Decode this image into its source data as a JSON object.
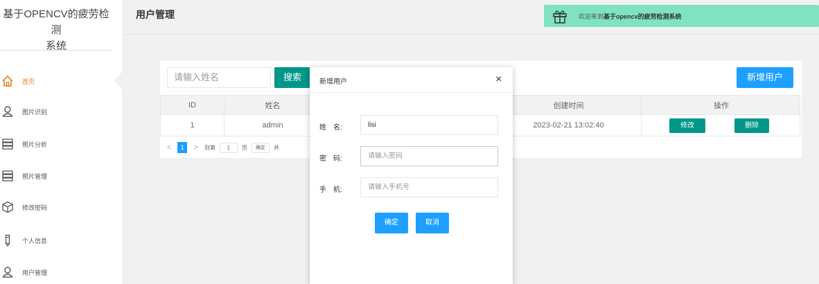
{
  "app": {
    "title_line1": "基于OPENCV的疲劳检测",
    "title_line2": "系统"
  },
  "sidebar": {
    "items": [
      {
        "label": "首页",
        "icon": "home-icon",
        "active": true
      },
      {
        "label": "图片识别",
        "icon": "user-icon"
      },
      {
        "label": "照片分析",
        "icon": "server-icon"
      },
      {
        "label": "照片管理",
        "icon": "server-icon"
      },
      {
        "label": "修改密码",
        "icon": "cube-icon"
      },
      {
        "label": "个人信息",
        "icon": "pencil-icon"
      },
      {
        "label": "用户管理",
        "icon": "user-icon"
      }
    ]
  },
  "header": {
    "title": "用户管理",
    "welcome_prefix": "欢迎来到",
    "welcome_bold": "基于opencv的疲劳检测系统"
  },
  "toolbar": {
    "search_placeholder": "请输入姓名",
    "search_label": "搜索",
    "add_label": "新增用户"
  },
  "table": {
    "columns": [
      "ID",
      "姓名",
      "创建时间",
      "操作"
    ],
    "rows": [
      {
        "id": "1",
        "name": "admin",
        "created": "2023-02-21 13:02:40"
      }
    ],
    "edit_label": "修改",
    "delete_label": "删除"
  },
  "pager": {
    "prev": "<",
    "current": "1",
    "next": ">",
    "goto_label": "到第",
    "goto_value": "1",
    "page_unit": "页",
    "ok_label": "确定",
    "total_label": "共"
  },
  "modal": {
    "title": "新增用户",
    "close": "×",
    "fields": [
      {
        "label": "姓　名:",
        "value": "lisi",
        "placeholder": ""
      },
      {
        "label": "密　码:",
        "value": "",
        "placeholder": "请输入密码"
      },
      {
        "label": "手　机:",
        "value": "",
        "placeholder": "请输入手机号"
      }
    ],
    "ok_label": "确定",
    "cancel_label": "取消"
  },
  "colors": {
    "primary": "#1e9fff",
    "teal": "#009688",
    "welcome_bg": "#7fe3c2",
    "active_nav": "#e67e22"
  }
}
